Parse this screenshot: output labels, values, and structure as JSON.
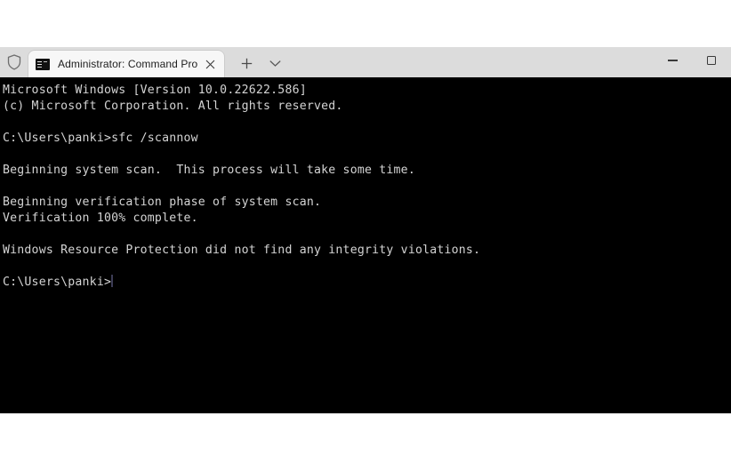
{
  "window": {
    "background_color": "#000000",
    "titlebar_color": "#dcdcdc",
    "text_color": "#d4d4d4"
  },
  "titlebar": {
    "shield_icon_name": "shield-icon",
    "tab": {
      "icon_name": "command-prompt-icon",
      "title": "Administrator: Command Pro",
      "close_label": "✕"
    },
    "new_tab_label": "+",
    "tab_menu_label": "⌄",
    "controls": {
      "minimize_label": "Minimize",
      "maximize_label": "Maximize"
    }
  },
  "terminal": {
    "lines": [
      "Microsoft Windows [Version 10.0.22622.586]",
      "(c) Microsoft Corporation. All rights reserved.",
      "",
      "C:\\Users\\panki>sfc /scannow",
      "",
      "Beginning system scan.  This process will take some time.",
      "",
      "Beginning verification phase of system scan.",
      "Verification 100% complete.",
      "",
      "Windows Resource Protection did not find any integrity violations.",
      ""
    ],
    "prompt": "C:\\Users\\panki>",
    "cursor_color": "#3c3c55"
  }
}
